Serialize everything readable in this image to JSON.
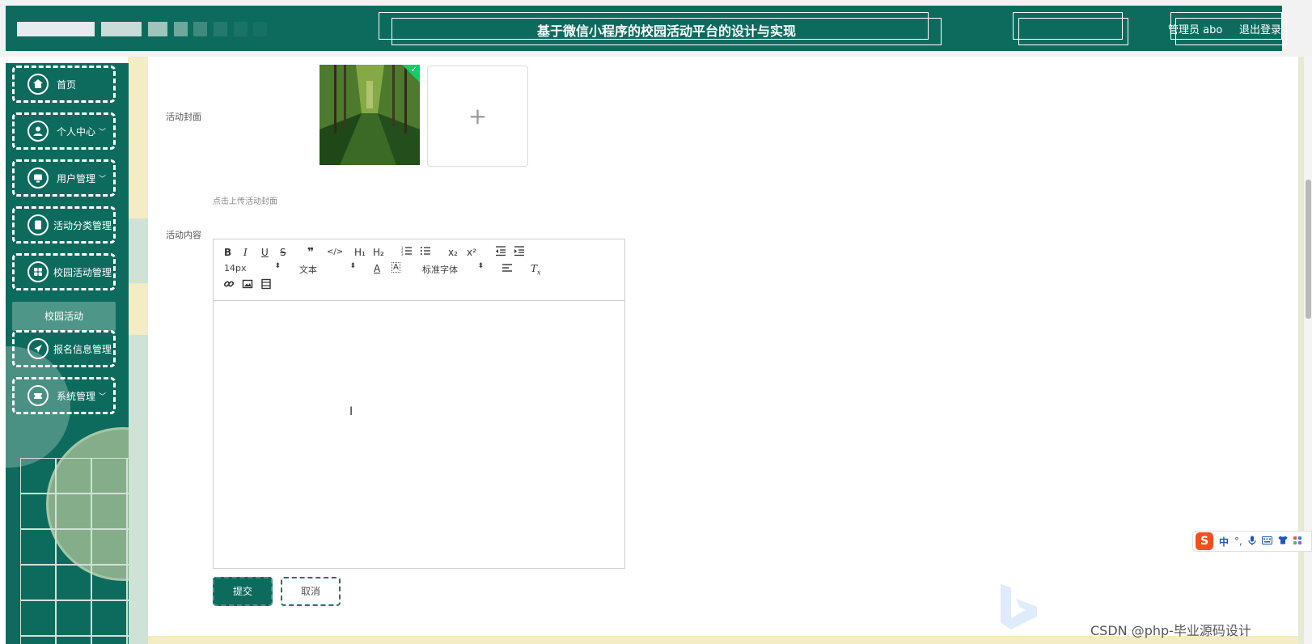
{
  "header": {
    "title": "基于微信小程序的校园活动平台的设计与实现",
    "admin": "管理员 abo",
    "logout": "退出登录"
  },
  "sidebar": {
    "items": [
      {
        "label": "首页",
        "icon": "home-icon"
      },
      {
        "label": "个人中心",
        "icon": "user-icon",
        "expandable": true
      },
      {
        "label": "用户管理",
        "icon": "monitor-icon",
        "expandable": true
      },
      {
        "label": "活动分类管理",
        "icon": "tablet-icon"
      },
      {
        "label": "校园活动管理",
        "icon": "grid-icon"
      },
      {
        "label": "报名信息管理",
        "icon": "paper-plane-icon"
      },
      {
        "label": "系统管理",
        "icon": "ticket-icon",
        "expandable": true
      }
    ],
    "submenu": {
      "label": "校园活动"
    }
  },
  "form": {
    "cover_label": "活动封面",
    "upload_hint": "点击上传活动封面",
    "content_label": "活动内容",
    "submit": "提交",
    "cancel": "取消"
  },
  "editor": {
    "toolbar": {
      "bold": "B",
      "italic": "I",
      "underline": "U",
      "strike": "S",
      "h1": "H₁",
      "h2": "H₂",
      "subscript": "x₂",
      "superscript": "x²",
      "size_value": "14px",
      "header_value": "文本",
      "font_value": "标准字体",
      "clean": "T"
    },
    "content": ""
  },
  "ime": {
    "label": "中"
  },
  "watermark": "CSDN @php-毕业源码设计",
  "colors": {
    "brand": "#0d6b5e",
    "submenu_active": "#4e9688",
    "success_check": "#13ce66"
  }
}
